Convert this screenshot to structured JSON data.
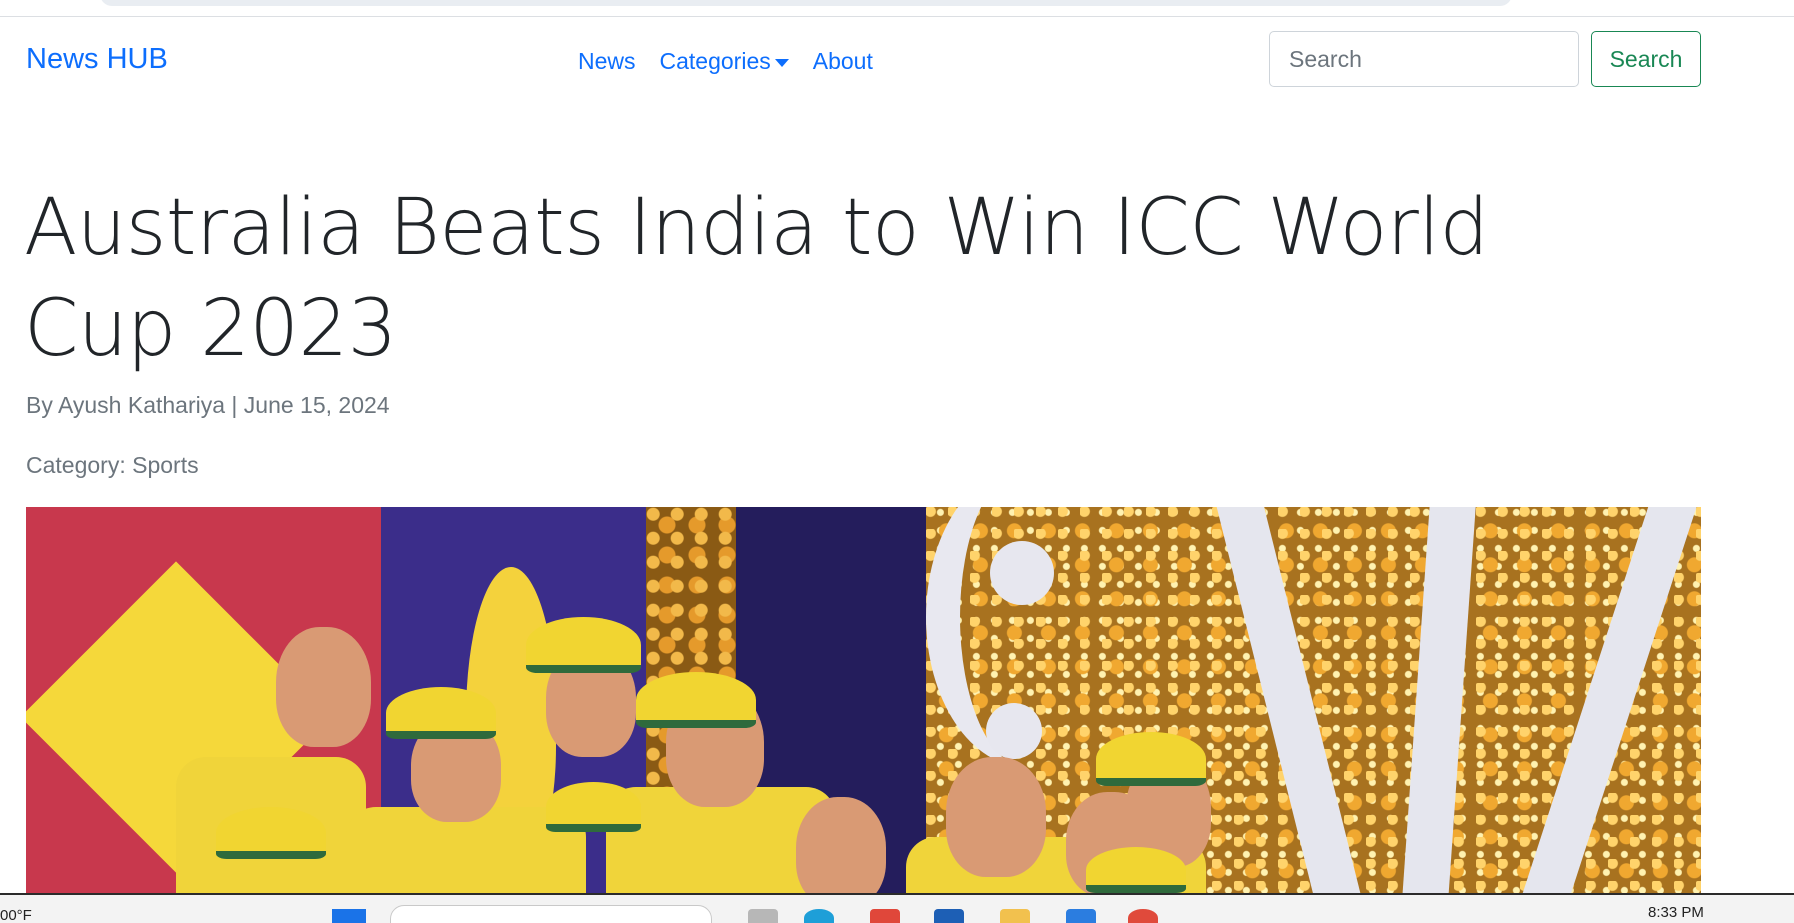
{
  "navbar": {
    "brand": "News HUB",
    "links": {
      "news": "News",
      "categories": "Categories",
      "about": "About"
    },
    "search_placeholder": "Search",
    "search_button": "Search"
  },
  "article": {
    "headline": "Australia Beats India to Win ICC World Cup 2023",
    "byline": "By Ayush Kathariya | June 15, 2024",
    "category": "Category: Sports"
  },
  "taskbar": {
    "temperature": "00°F",
    "time": "8:33 PM"
  },
  "colors": {
    "link": "#0d6efd",
    "success": "#198754",
    "muted": "#6c757d"
  }
}
